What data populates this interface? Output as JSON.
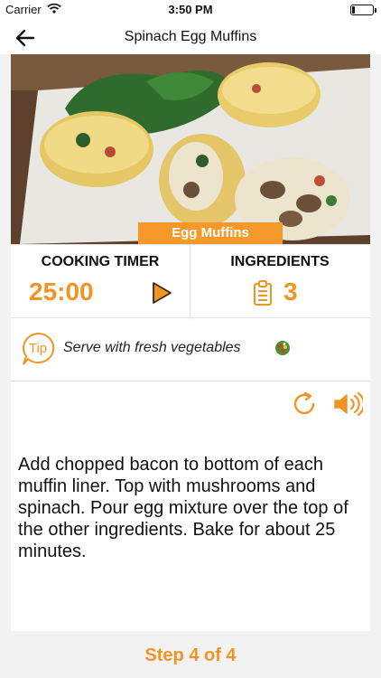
{
  "status_bar": {
    "carrier": "Carrier",
    "time": "3:50 PM",
    "battery_level": 0.15
  },
  "nav": {
    "back_icon": "arrow-left-icon",
    "title": "Spinach Egg Muffins"
  },
  "hero": {
    "badge": "Egg Muffins"
  },
  "stats": {
    "timer_title": "COOKING TIMER",
    "timer_value": "25:00",
    "play_icon": "play-icon",
    "ingredients_title": "INGREDIENTS",
    "ingredients_icon": "clipboard-list-icon",
    "ingredients_count": "3"
  },
  "tip": {
    "badge": "Tip",
    "text": "Serve with fresh vegetables",
    "emoji_icon": "salad-icon"
  },
  "controls": {
    "replay_icon": "replay-icon",
    "speaker_icon": "speaker-icon"
  },
  "step": {
    "instruction": "Add chopped bacon to bottom of each muffin liner. Top with mushrooms and spinach. Pour egg mixture over the top of the other ingredients. Bake for about 25 minutes.",
    "indicator": "Step 4 of 4"
  },
  "colors": {
    "accent": "#f29424",
    "badge": "#f59a2a",
    "card_background": "#ffffff",
    "page_background": "#f2f2f2"
  }
}
